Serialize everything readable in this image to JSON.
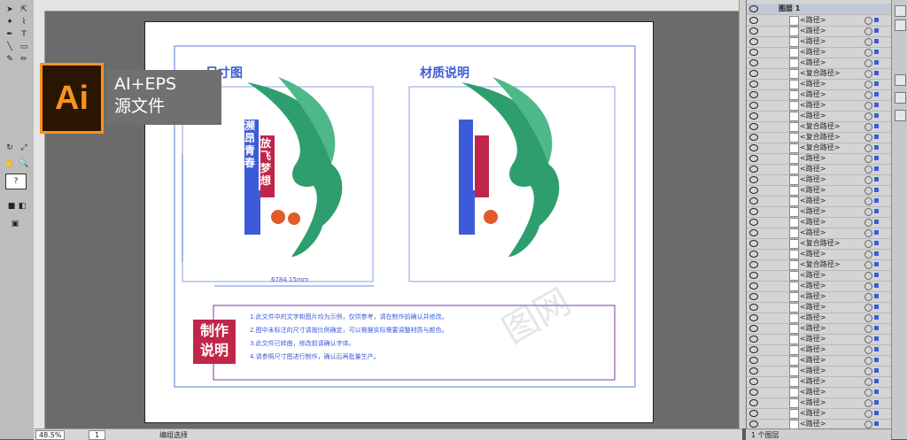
{
  "badge": {
    "logo": "Ai",
    "line1": "AI+EPS",
    "line2": "源文件"
  },
  "artwork": {
    "heading_left": "尺寸图",
    "heading_right": "材质说明",
    "vertical_title": "濒昂青春",
    "vertical_subtitle": "放飞梦想",
    "dimension_label": "6784.15mm",
    "notes_title": "制作说明",
    "notes": [
      "1.此文件中的文字和图片均为示例，仅供参考，请在制作前确认并修改。",
      "2.图中未标注的尺寸请按比例确定，可以根据实际需要调整材质与颜色。",
      "3.此文件已转曲，修改前请确认字体。",
      "4.请参照尺寸图进行制作，确认后再批量生产。"
    ],
    "watermark": "图网"
  },
  "layers": {
    "top_layer": "图层 1",
    "items": [
      "<路径>",
      "<路径>",
      "<路径>",
      "<路径>",
      "<路径>",
      "<复合路径>",
      "<路径>",
      "<路径>",
      "<路径>",
      "<路径>",
      "<复合路径>",
      "<复合路径>",
      "<复合路径>",
      "<路径>",
      "<路径>",
      "<路径>",
      "<路径>",
      "<路径>",
      "<路径>",
      "<路径>",
      "<路径>",
      "<复合路径>",
      "<路径>",
      "<复合路径>",
      "<路径>",
      "<路径>",
      "<路径>",
      "<路径>",
      "<路径>",
      "<路径>",
      "<路径>",
      "<路径>",
      "<路径>",
      "<路径>",
      "<路径>",
      "<路径>",
      "<路径>",
      "<路径>",
      "<路径>"
    ],
    "footer": "1 个图层"
  },
  "status": {
    "zoom": "48.5%",
    "page": "1",
    "mode": "编组选择"
  },
  "colors": {
    "green": "#2e9e6e",
    "blue": "#3b5bdb",
    "red": "#c0264a",
    "orange": "#f7931e",
    "purple": "#7a3aa8"
  }
}
